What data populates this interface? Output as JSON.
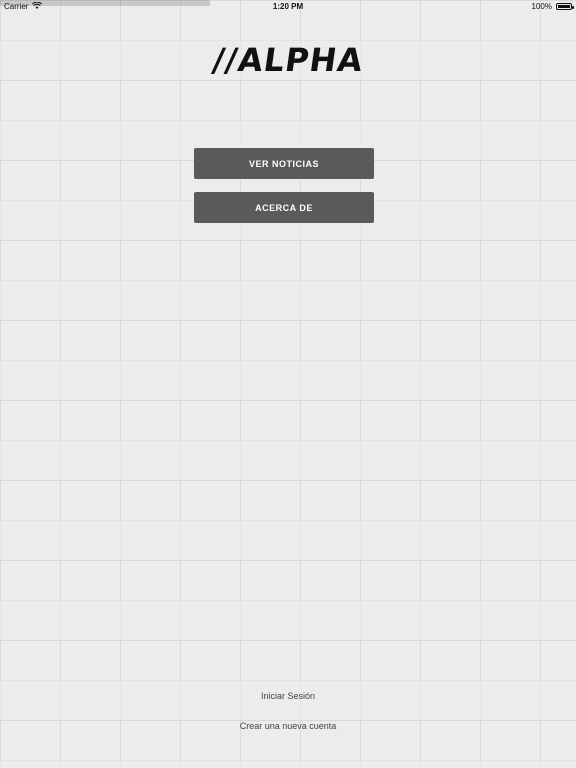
{
  "status_bar": {
    "carrier": "Carrier",
    "time": "1:20 PM",
    "battery": "100%",
    "wifi_icon": "wifi-icon",
    "battery_icon": "battery-icon"
  },
  "app": {
    "logo_text": "//ALPHA"
  },
  "menu": {
    "news_button": "VER NOTICIAS",
    "about_button": "ACERCA DE"
  },
  "auth": {
    "login_link": "Iniciar Sesión",
    "signup_link": "Crear una nueva cuenta"
  },
  "colors": {
    "button_bg": "#5a5a5a",
    "button_text": "#ffffff",
    "background": "#ececec",
    "link_text": "#444444"
  }
}
